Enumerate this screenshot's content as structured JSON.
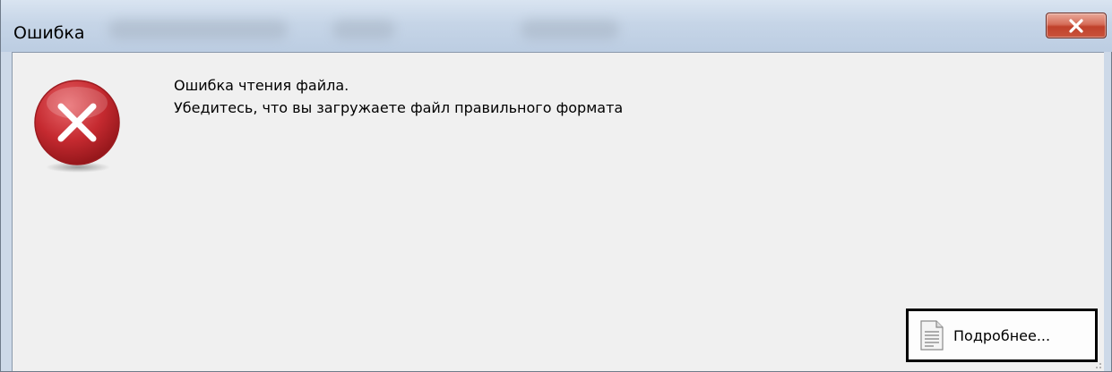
{
  "window": {
    "title": "Ошибка"
  },
  "titlebar": {
    "close_icon": "close-x-icon"
  },
  "dialog": {
    "icon": "error-icon",
    "message_line1": "Ошибка чтения файла.",
    "message_line2": "Убедитесь, что вы загружаете файл правильного формата"
  },
  "details_button": {
    "label": "Подробнее...",
    "icon": "document-icon"
  },
  "colors": {
    "error_red": "#c0282d",
    "close_button_red": "#c9452e",
    "client_bg": "#f0f0f0"
  }
}
